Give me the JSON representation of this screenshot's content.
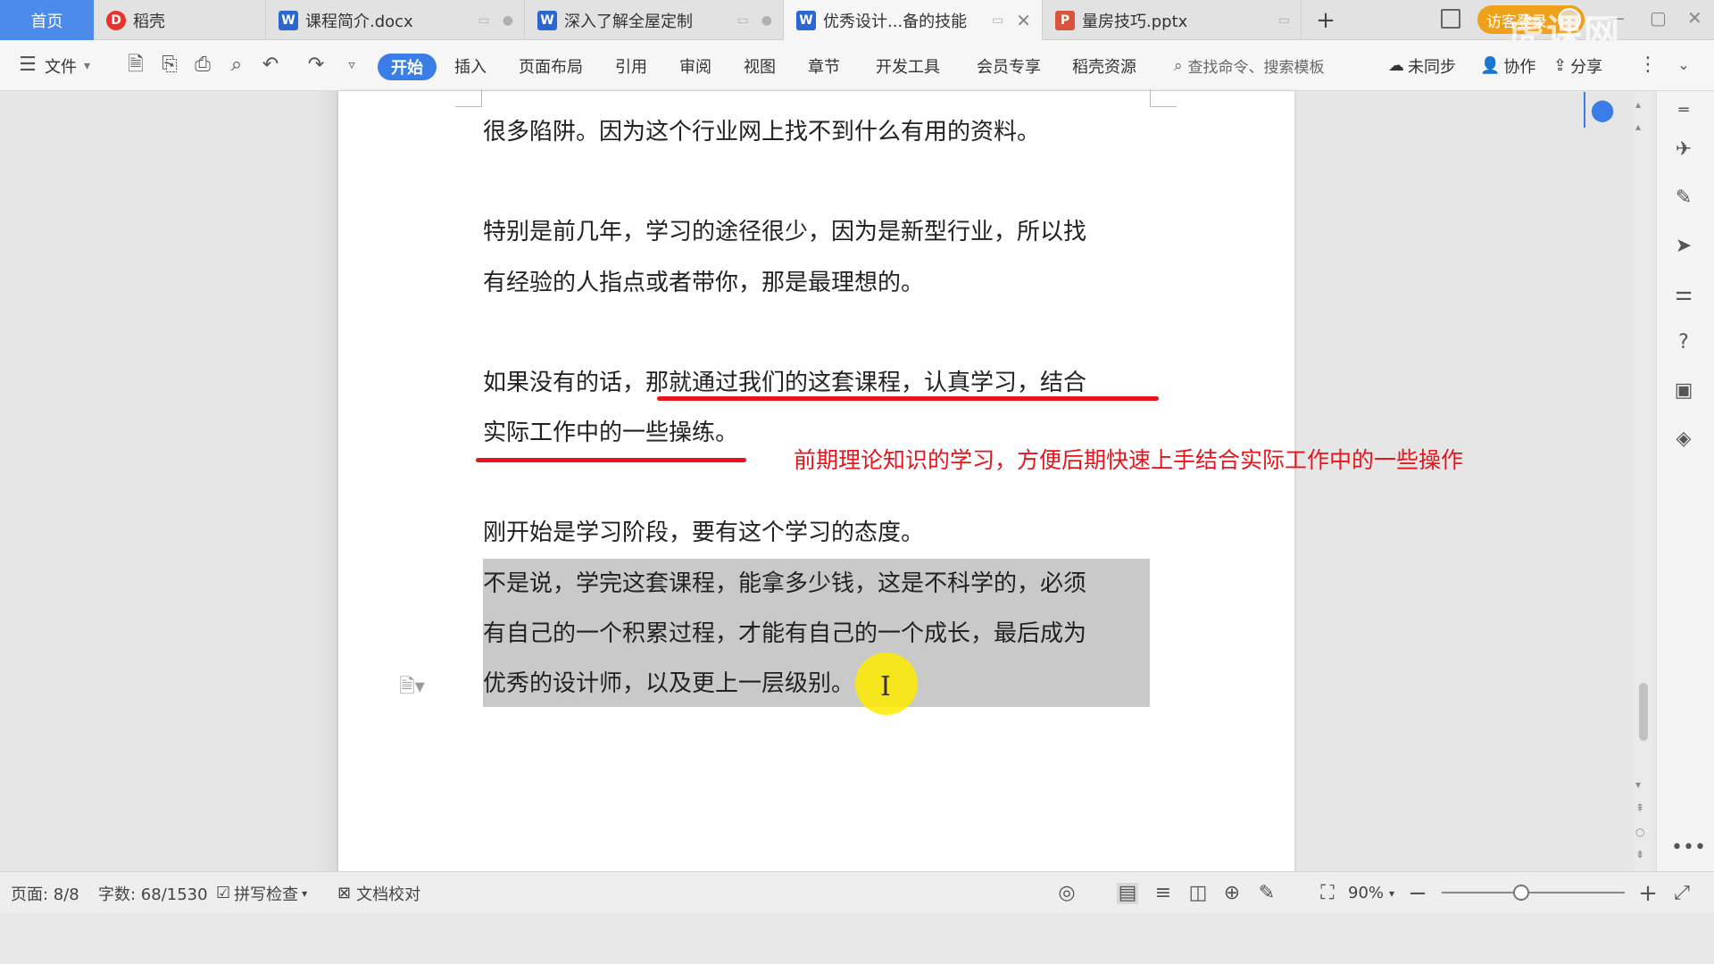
{
  "tabs": {
    "home": "首页",
    "items": [
      {
        "label": "稻壳",
        "icon": "daoke-icon"
      },
      {
        "label": "课程简介.docx",
        "icon": "word-doc-icon"
      },
      {
        "label": "深入了解全屋定制",
        "icon": "word-doc-icon"
      },
      {
        "label": "优秀设计...备的技能",
        "icon": "word-doc-icon"
      },
      {
        "label": "量房技巧.pptx",
        "icon": "ppt-icon"
      }
    ],
    "add": "+",
    "login": "访客登录",
    "watermark": "虎课网"
  },
  "ribbon": {
    "file": "文件",
    "menus": [
      "开始",
      "插入",
      "页面布局",
      "引用",
      "审阅",
      "视图",
      "章节",
      "开发工具",
      "会员专享",
      "稻壳资源"
    ],
    "search_placeholder": "查找命令、搜索模板",
    "sync": "未同步",
    "collab": "协作",
    "share": "分享"
  },
  "document": {
    "lines": [
      "很多陷阱。因为这个行业网上找不到什么有用的资料。",
      "特别是前几年，学习的途径很少，因为是新型行业，所以找",
      "有经验的人指点或者带你，那是最理想的。",
      "如果没有的话，那就通过我们的这套课程，认真学习，结合",
      "实际工作中的一些操练。",
      "刚开始是学习阶段，要有这个学习的态度。",
      "不是说，学完这套课程，能拿多少钱，这是不科学的，必须",
      "有自己的一个积累过程，才能有自己的一个成长，最后成为",
      "优秀的设计师，以及更上一层级别。"
    ],
    "annotation": "前期理论知识的学习，方便后期快速上手结合实际工作中的一些操作"
  },
  "status": {
    "page": "页面: 8/8",
    "words": "字数: 68/1530",
    "spell": "拼写检查",
    "proof": "文档校对",
    "zoom": "90%"
  }
}
